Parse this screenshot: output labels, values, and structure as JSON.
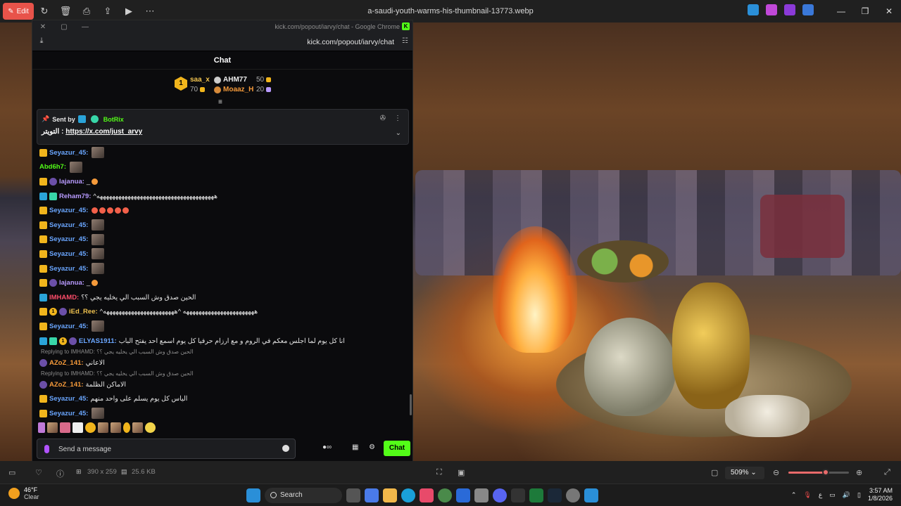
{
  "viewer": {
    "edit_label": "Edit",
    "file_title": "a-saudi-youth-warms-his-thumbnail-13773.webp",
    "zoom": "509%",
    "zoom_fraction": 0.62,
    "dimensions": "390 x 259",
    "file_size": "25.6 KB"
  },
  "chrome": {
    "window_title": "kick.com/popout/iarvy/chat - Google Chrome",
    "address": "kick.com/popout/iarvy/chat"
  },
  "chat": {
    "header": "Chat",
    "leaderboard": {
      "rank": "1",
      "first": {
        "name": "saa_x",
        "value": "70"
      },
      "second": {
        "name": "AHM77",
        "value": "50"
      },
      "third": {
        "name": "Moaaz_H",
        "value": "20"
      }
    },
    "pinned": {
      "sent_by_label": "Sent by",
      "sender": "BotRix",
      "prefix": "التويتر : ",
      "link": "https://x.com/just_arvy"
    },
    "messages": [
      {
        "user": "Seyazur_45:",
        "color": "#6aa6ff",
        "badges": [
          "crown"
        ],
        "text": "",
        "emote": true
      },
      {
        "user": "Abd6h7:",
        "color": "#53fc18",
        "badges": [],
        "text": "",
        "emote": true
      },
      {
        "user": "lajanua:",
        "color": "#b89aff",
        "badges": [
          "crown",
          "moon"
        ],
        "text": "_",
        "emoji": true
      },
      {
        "user": "Reham79:",
        "color": "#b89aff",
        "badges": [
          "staff",
          "grn"
        ],
        "text": "^ههههههههههههههههههههههههههههههههههههههه",
        "emote": false
      },
      {
        "user": "Seyazur_45:",
        "color": "#6aa6ff",
        "badges": [
          "crown"
        ],
        "text": "",
        "emojis": 5
      },
      {
        "user": "Seyazur_45:",
        "color": "#6aa6ff",
        "badges": [
          "crown"
        ],
        "text": "",
        "emote": true
      },
      {
        "user": "Seyazur_45:",
        "color": "#6aa6ff",
        "badges": [
          "crown"
        ],
        "text": "",
        "emote": true
      },
      {
        "user": "Seyazur_45:",
        "color": "#6aa6ff",
        "badges": [
          "crown"
        ],
        "text": "",
        "emote": true
      },
      {
        "user": "Seyazur_45:",
        "color": "#6aa6ff",
        "badges": [
          "crown"
        ],
        "text": "",
        "emote": true
      },
      {
        "user": "lajanua:",
        "color": "#b89aff",
        "badges": [
          "crown",
          "moon"
        ],
        "text": "_",
        "emoji": true
      },
      {
        "user": "IMHAMD:",
        "color": "#ff4d6a",
        "badges": [
          "staff"
        ],
        "text": "الحين صدق وش السبب الي يخليه يجي ؟؟"
      },
      {
        "user": "iEd_Ree:",
        "color": "#f1c34f",
        "badges": [
          "crown",
          "num1",
          "moon"
        ],
        "text": "^هههههههههههههههههههههههه ^هههههههههههههههههههههههه"
      },
      {
        "user": "Seyazur_45:",
        "color": "#6aa6ff",
        "badges": [
          "crown"
        ],
        "text": "",
        "emote": true
      },
      {
        "user": "ELYAS1911:",
        "color": "#6aa6ff",
        "badges": [
          "staff",
          "grn",
          "num1",
          "moon"
        ],
        "text": "انا كل يوم لما اجلس معكم في الروم و مع ارزام حرفيا كل يوم اسمع احد يفتح الباب"
      },
      {
        "reply": "Replying to IMHAMD: الحين صدق وش السبب الي يخليه يجي ؟؟"
      },
      {
        "user": "AZoZ_141:",
        "color": "#f59a3a",
        "badges": [
          "moon"
        ],
        "text": "الاعاني"
      },
      {
        "reply": "Replying to IMHAMD: الحين صدق وش السبب الي يخليه يجي ؟؟"
      },
      {
        "user": "AZoZ_141:",
        "color": "#f59a3a",
        "badges": [
          "moon"
        ],
        "text": "الاماكن الظلمة"
      },
      {
        "user": "Seyazur_45:",
        "color": "#6aa6ff",
        "badges": [
          "crown"
        ],
        "text": "الياس كل يوم يسلم على واحد منهم"
      },
      {
        "user": "Seyazur_45:",
        "color": "#6aa6ff",
        "badges": [
          "crown"
        ],
        "text": "",
        "emote": true
      }
    ],
    "input_placeholder": "Send a message",
    "chat_button": "Chat"
  },
  "taskbar": {
    "temp": "46°F",
    "condition": "Clear",
    "search": "Search",
    "time": "3:57 AM",
    "date": "1/8/2026",
    "lang": "ع"
  },
  "colors": {
    "kick_green": "#53fc18",
    "edit_red": "#e8534a",
    "crown_gold": "#f1b51c"
  }
}
